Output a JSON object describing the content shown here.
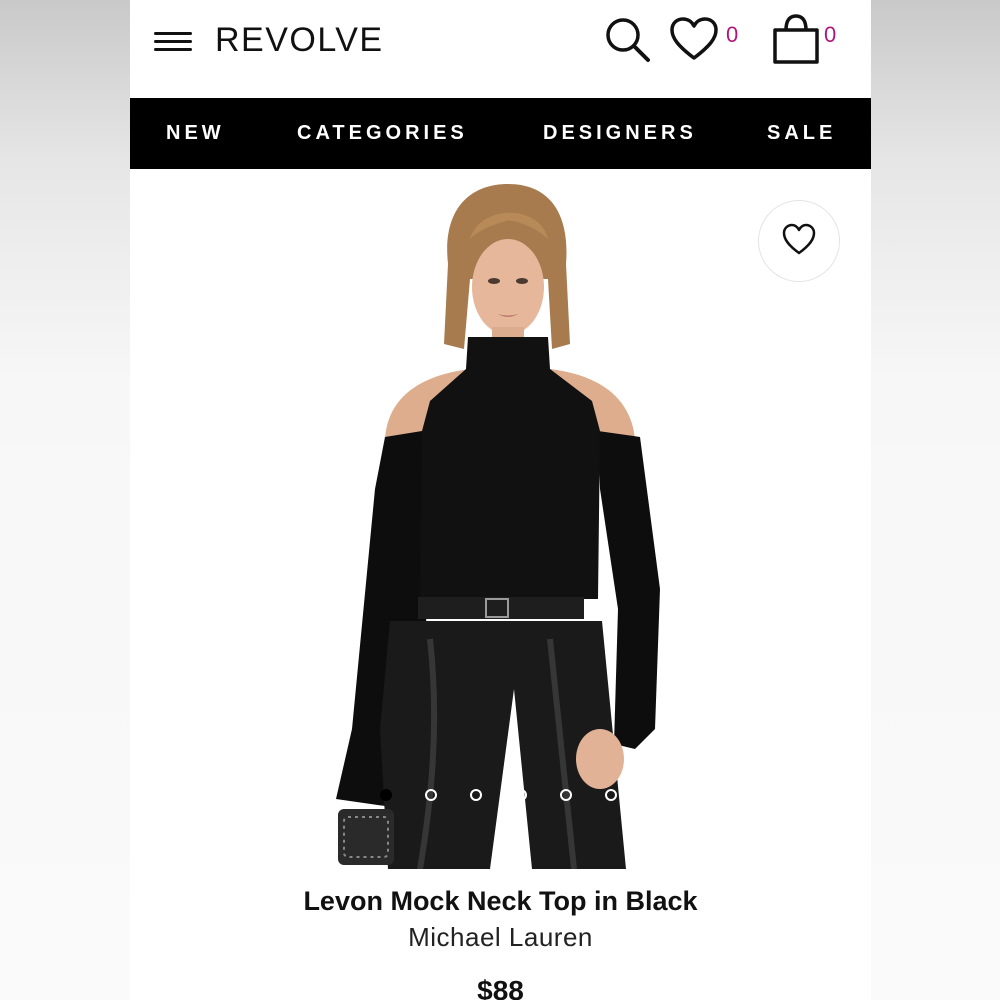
{
  "header": {
    "logo": "REVOLVE",
    "wishlist_count": "0",
    "bag_count": "0",
    "accent_color": "#b0177a"
  },
  "nav": {
    "items": [
      {
        "label": "NEW"
      },
      {
        "label": "CATEGORIES"
      },
      {
        "label": "DESIGNERS"
      },
      {
        "label": "SALE"
      }
    ]
  },
  "gallery": {
    "image_count": 6,
    "active_index": 0
  },
  "product": {
    "name": "Levon Mock Neck Top in Black",
    "designer": "Michael Lauren",
    "price": "$88"
  },
  "icons": [
    "menu-icon",
    "search-icon",
    "heart-icon",
    "bag-icon",
    "heart-outline-icon"
  ]
}
